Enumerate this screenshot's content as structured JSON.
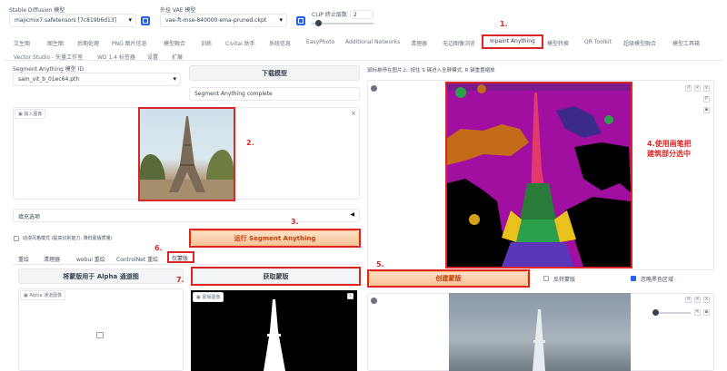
{
  "top": {
    "sd_model_label": "Stable Diffusion 模型",
    "sd_model_value": "majicmix7.safetensors [7c819b6d13]",
    "vae_label": "外挂 VAE 模型",
    "vae_value": "vae-ft-mse-840000-ema-pruned.ckpt",
    "clip_label": "CLIP 终止层数",
    "clip_value": "2"
  },
  "tabs_row1": [
    "文生图",
    "图生图",
    "后期处理",
    "PNG 图片信息",
    "模型融合",
    "训练",
    "Civitai 助手",
    "系统信息",
    "EasyPhoto",
    "Additional Networks",
    "清理器",
    "无边图像浏览",
    "Inpaint Anything",
    "模型转换",
    "QR Toolkit",
    "超级模型融合",
    "模型工具箱"
  ],
  "tabs_row2": [
    "Vector Studio - 矢量工作室",
    "WD 1.4 标签器",
    "设置",
    "扩展"
  ],
  "left": {
    "sam_label": "Segment Anything 模型 ID",
    "sam_value": "sam_vit_b_01ec64.pth",
    "download_btn": "下载模型",
    "status": "Segment Anything complete",
    "input_image_tag": "输入图像",
    "fill_options": "填充选项",
    "anime_checkbox": "动漫风格模式 (提高识别能力, 降低蒙版质量)",
    "run_btn": "运行 Segment Anything",
    "subtabs": [
      "重绘",
      "清理器",
      "webui 重绘",
      "ControlNet 重绘",
      "仅蒙版"
    ],
    "alpha_btn": "将蒙版用于 Alpha 通道图",
    "get_mask_btn": "获取蒙版",
    "alpha_tag": "Alpha 通道图像",
    "mask_tag": "蒙版图像"
  },
  "right": {
    "hint": "鼠标悬停在图片上: 按住 S 键进入全屏模式, R 键重置缩放",
    "create_mask_btn": "创建蒙版",
    "invert_label": "反转蒙版",
    "ignore_black_label": "忽略黑色区域"
  },
  "annotations": {
    "a1": "1.",
    "a2": "2.",
    "a3": "3.",
    "a4_line1": "4.使用画笔把",
    "a4_line2": "建筑部分选中",
    "a5": "5.",
    "a6": "6.",
    "a7": "7."
  },
  "colors": {
    "accent": "#2563eb",
    "annotation_red": "#dc2626",
    "orange_button": "#f8c49a"
  }
}
